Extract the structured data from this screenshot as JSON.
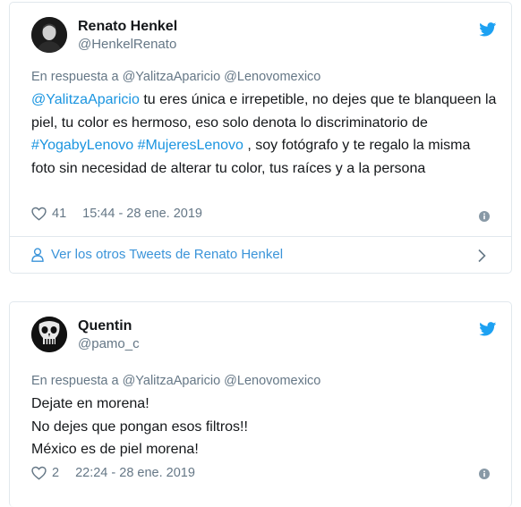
{
  "tweets": [
    {
      "name": "Renato Henkel",
      "handle": "@HenkelRenato",
      "reply_prefix": "En respuesta a",
      "reply_to": "@YalitzaAparicio @Lenovomexico",
      "segments": [
        {
          "text": "@YalitzaAparicio",
          "link": true
        },
        {
          "text": " tu eres única e irrepetible, no dejes que te blanqueen la piel, tu color es hermoso, eso solo denota lo discriminatorio de ",
          "link": false
        },
        {
          "text": "#YogabyLenovo",
          "link": true
        },
        {
          "text": " ",
          "link": false
        },
        {
          "text": "#MujeresLenovo",
          "link": true
        },
        {
          "text": " , soy fotógrafo y te regalo la misma foto sin necesidad de alterar tu color, tus raíces y a la persona",
          "link": false
        }
      ],
      "likes": "41",
      "timestamp": "15:44 - 28 ene. 2019",
      "more_tweets": "Ver los otros Tweets de Renato Henkel"
    },
    {
      "name": "Quentin",
      "handle": "@pamo_c",
      "reply_prefix": "En respuesta a",
      "reply_to": "@YalitzaAparicio @Lenovomexico",
      "lines": [
        "Dejate en morena!",
        "No dejes que pongan esos filtros!!",
        "México es de piel morena!"
      ],
      "likes": "2",
      "timestamp": "22:24 - 28 ene. 2019"
    }
  ],
  "colors": {
    "link": "#1b95e0",
    "muted": "#657786",
    "border": "#e1e8ed",
    "bird": "#1da1f2"
  },
  "icons": {
    "brand": "twitter-bird-icon",
    "like": "heart-outline-icon",
    "info": "info-icon",
    "profile": "person-icon",
    "arrow": "chevron-right-icon"
  }
}
